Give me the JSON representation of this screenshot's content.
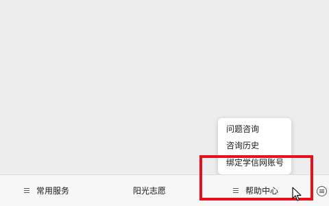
{
  "popup": {
    "items": [
      {
        "label": "问题咨询"
      },
      {
        "label": "咨询历史"
      },
      {
        "label": "绑定学信网账号"
      }
    ]
  },
  "bottom_bar": {
    "buttons": [
      {
        "label": "常用服务",
        "icon": "menu-lines-icon"
      },
      {
        "label": "阳光志愿"
      },
      {
        "label": "帮助中心",
        "icon": "menu-lines-icon"
      }
    ],
    "keyboard_icon": "keyboard-toggle-icon"
  },
  "colors": {
    "background": "#ededed",
    "bar_background": "#f7f7f7",
    "highlight": "#e8101a",
    "text": "#1a1a1a"
  }
}
